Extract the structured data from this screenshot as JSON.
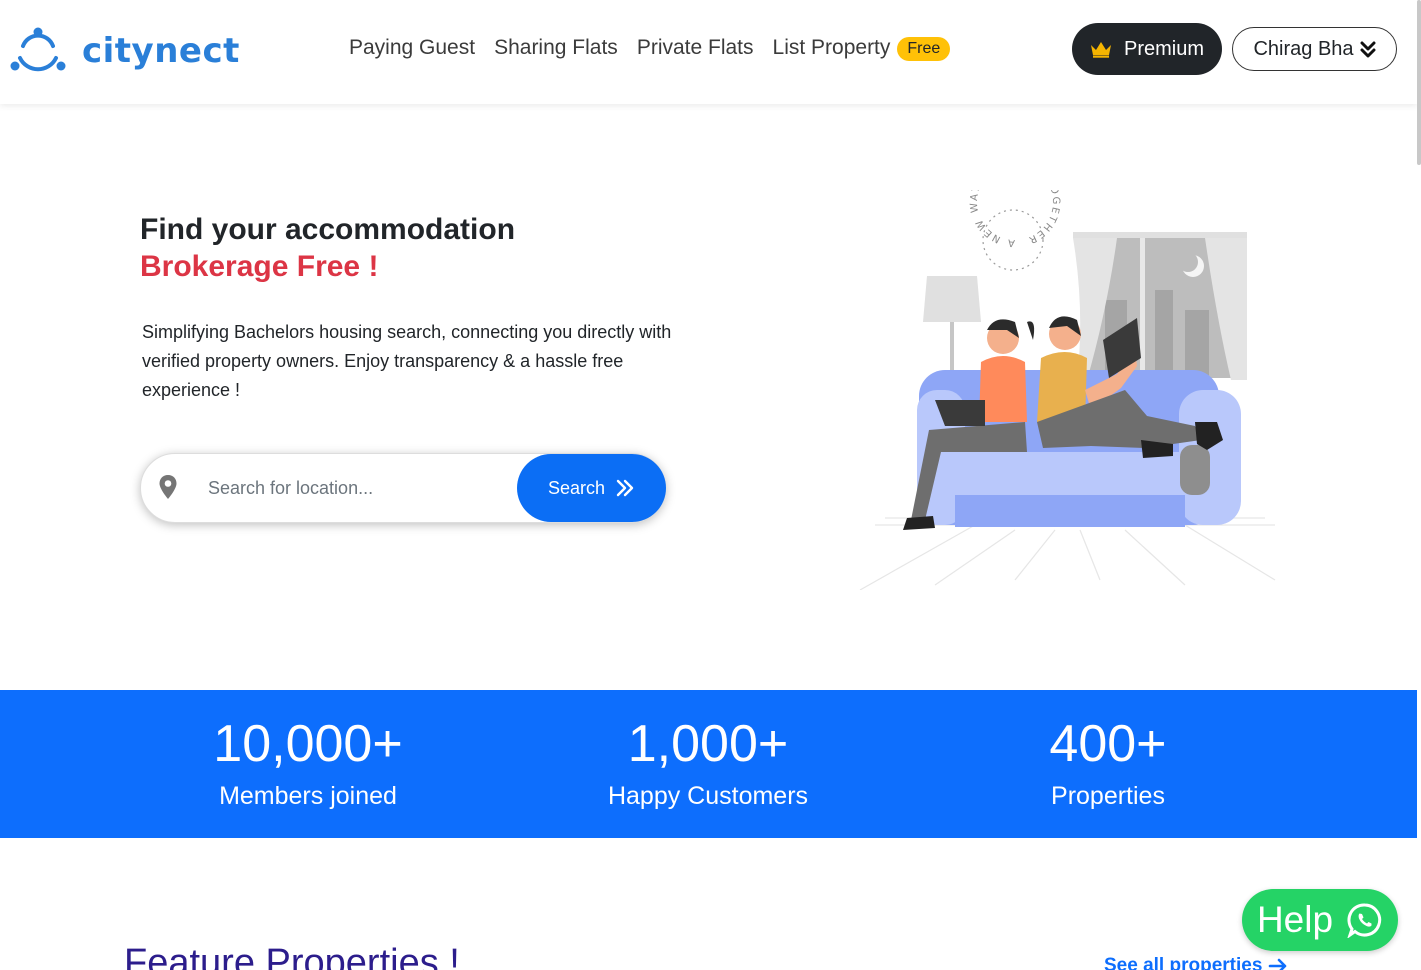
{
  "header": {
    "logo_text": "citynect",
    "nav": [
      {
        "label": "Paying Guest"
      },
      {
        "label": "Sharing Flats"
      },
      {
        "label": "Private Flats"
      },
      {
        "label": "List Property"
      }
    ],
    "free_badge": "Free",
    "premium_label": "Premium",
    "user_label": "Chirag Bha"
  },
  "hero": {
    "title": "Find your accommodation",
    "subtitle": "Brokerage Free !",
    "description": "Simplifying Bachelors housing search, connecting you directly with verified property owners. Enjoy transparency & a hassle free experience !",
    "search_placeholder": "Search for location...",
    "search_button": "Search",
    "illustration_badge": "A NEW WAY OF LIVING TOGETHER"
  },
  "stats": [
    {
      "number": "10,000+",
      "label": "Members joined"
    },
    {
      "number": "1,000+",
      "label": "Happy Customers"
    },
    {
      "number": "400+",
      "label": "Properties"
    }
  ],
  "featured": {
    "title": "Feature Properties !",
    "see_all": "See all properties"
  },
  "help": {
    "label": "Help"
  },
  "colors": {
    "brand": "#2a7fd8",
    "primary": "#0d6efd",
    "danger": "#dc3545",
    "badge": "#ffc107",
    "whatsapp": "#25d366",
    "dark": "#212529"
  },
  "icons": [
    "logo-icon",
    "crown-icon",
    "chevron-down-icon",
    "location-pin-icon",
    "double-chevron-right-icon",
    "arrow-right-icon",
    "whatsapp-icon"
  ]
}
